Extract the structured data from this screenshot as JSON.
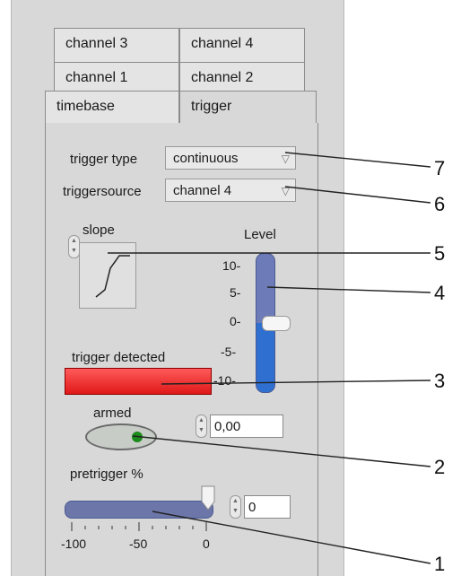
{
  "tabs": {
    "row1": [
      "channel 3",
      "channel 4"
    ],
    "row2": [
      "channel 1",
      "channel 2"
    ],
    "row3": [
      "timebase",
      "trigger"
    ]
  },
  "trigger_type": {
    "label": "trigger type",
    "value": "continuous"
  },
  "trigger_source": {
    "label": "triggersource",
    "value": "channel 4"
  },
  "slope": {
    "label": "slope"
  },
  "level": {
    "label": "Level",
    "ticks": [
      "10-",
      "5-",
      "0-",
      "-5-",
      "-10-"
    ],
    "value": 0,
    "min": -10,
    "max": 10,
    "numeric_value": "0,00"
  },
  "trigger_detected": {
    "label": "trigger detected",
    "state": "on",
    "color": "#e82020"
  },
  "armed": {
    "label": "armed"
  },
  "pretrigger": {
    "label": "pretrigger %",
    "value": 0,
    "min": -100,
    "max": 0,
    "ticks": [
      "-100",
      "-50",
      "0"
    ],
    "numeric_value": "0"
  },
  "callouts": [
    "7",
    "6",
    "5",
    "4",
    "3",
    "2",
    "1"
  ],
  "colors": {
    "panel": "#d8d8d8",
    "slider_fill": "#2f6fd0",
    "slider_track": "#6d7cb8",
    "led": "#e82020",
    "armed_led": "#1a8a1a"
  }
}
